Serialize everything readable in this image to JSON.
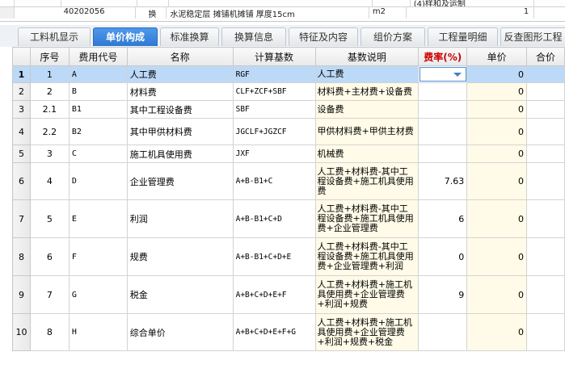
{
  "top_partial": {
    "row1_tail": "(4)样和及运制",
    "row2_code": "40202056",
    "row2_type": "换",
    "row2_name": "水泥稳定层 摊铺机摊铺 厚度15cm",
    "row2_unit": "m2",
    "row2_qty": "1"
  },
  "tabs": [
    {
      "label": "工料机显示"
    },
    {
      "label": "单价构成",
      "active": true
    },
    {
      "label": "标准换算"
    },
    {
      "label": "换算信息"
    },
    {
      "label": "特征及内容"
    },
    {
      "label": "组价方案"
    },
    {
      "label": "工程量明细"
    },
    {
      "label": "反查图形工程"
    }
  ],
  "grid": {
    "headers": {
      "seq": "序号",
      "code": "费用代号",
      "name": "名称",
      "base": "计算基数",
      "desc": "基数说明",
      "rate": "费率(%)",
      "price": "单价",
      "total": "合价"
    },
    "rows": [
      {
        "rn": "1",
        "seq": "1",
        "code": "A",
        "name": "人工费",
        "base": "RGF",
        "desc": "人工费",
        "rate": "",
        "price": "0",
        "selected": true
      },
      {
        "rn": "2",
        "seq": "2",
        "code": "B",
        "name": "材料费",
        "base": "CLF+ZCF+SBF",
        "desc": "材料费+主材费+设备费",
        "rate": "",
        "price": "0"
      },
      {
        "rn": "3",
        "seq": "2.1",
        "code": "B1",
        "name": "其中工程设备费",
        "base": "SBF",
        "desc": "设备费",
        "rate": "",
        "price": "0"
      },
      {
        "rn": "4",
        "seq": "2.2",
        "code": "B2",
        "name": "其中甲供材料费",
        "base": "JGCLF+JGZCF",
        "desc": "甲供材料费+甲供主材费",
        "rate": "",
        "price": "0"
      },
      {
        "rn": "5",
        "seq": "3",
        "code": "C",
        "name": "施工机具使用费",
        "base": "JXF",
        "desc": "机械费",
        "rate": "",
        "price": "0"
      },
      {
        "rn": "6",
        "seq": "4",
        "code": "D",
        "name": "企业管理费",
        "base": "A+B-B1+C",
        "desc": "人工费+材料费-其中工程设备费+施工机具使用费",
        "rate": "7.63",
        "price": "0"
      },
      {
        "rn": "7",
        "seq": "5",
        "code": "E",
        "name": "利润",
        "base": "A+B-B1+C+D",
        "desc": "人工费+材料费-其中工程设备费+施工机具使用费+企业管理费",
        "rate": "6",
        "price": "0"
      },
      {
        "rn": "8",
        "seq": "6",
        "code": "F",
        "name": "规费",
        "base": "A+B-B1+C+D+E",
        "desc": "人工费+材料费-其中工程设备费+施工机具使用费+企业管理费+利润",
        "rate": "0",
        "price": "0"
      },
      {
        "rn": "9",
        "seq": "7",
        "code": "G",
        "name": "税金",
        "base": "A+B+C+D+E+F",
        "desc": "人工费+材料费+施工机具使用费+企业管理费+利润+规费",
        "rate": "9",
        "price": "0"
      },
      {
        "rn": "10",
        "seq": "8",
        "code": "H",
        "name": "综合单价",
        "base": "A+B+C+D+E+F+G",
        "desc": "人工费+材料费+施工机具使用费+企业管理费+利润+规费+税金",
        "rate": "",
        "price": "0"
      }
    ]
  }
}
